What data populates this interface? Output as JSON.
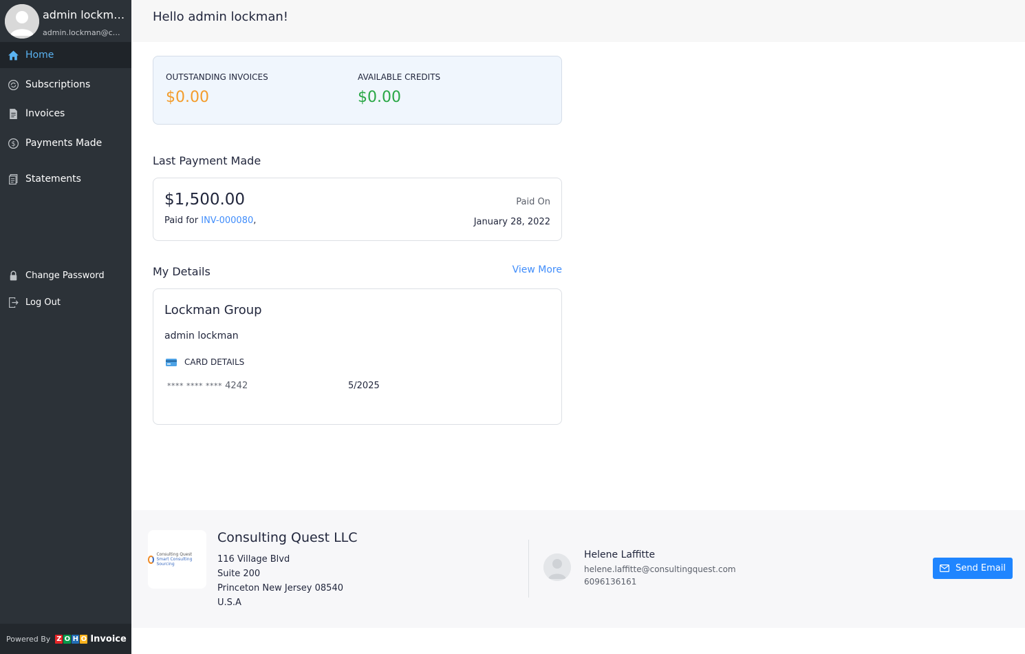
{
  "profile": {
    "name": "admin lockman",
    "email": "admin.lockman@consultingquest.com"
  },
  "nav": {
    "home": "Home",
    "subscriptions": "Subscriptions",
    "invoices": "Invoices",
    "payments_made": "Payments Made",
    "statements": "Statements",
    "change_password": "Change Password",
    "log_out": "Log Out"
  },
  "powered_by": {
    "label": "Powered By",
    "brand_letters": [
      "Z",
      "O",
      "H",
      "O"
    ],
    "product": "Invoice"
  },
  "header": {
    "greeting": "Hello admin lockman!"
  },
  "summary": {
    "outstanding_label": "OUTSTANDING INVOICES",
    "outstanding_value": "$0.00",
    "credits_label": "AVAILABLE CREDITS",
    "credits_value": "$0.00"
  },
  "last_payment": {
    "title": "Last Payment Made",
    "amount": "$1,500.00",
    "paid_for_label": "Paid for",
    "invoice_number": "INV-000080",
    "invoice_suffix": ",",
    "paid_on_label": "Paid On",
    "paid_on_date": "January 28, 2022"
  },
  "my_details": {
    "title": "My Details",
    "view_more": "View More",
    "company": "Lockman Group",
    "contact": "admin lockman",
    "card_details_label": "CARD DETAILS",
    "card_mask": "**** **** ****",
    "card_last4": "4242",
    "card_expiry": "5/2025"
  },
  "footer": {
    "org_name": "Consulting Quest LLC",
    "logo_text_1": "Consulting Quest",
    "logo_text_2": "Smart Consulting Sourcing",
    "address_lines": [
      "116 Village Blvd",
      "Suite 200",
      "Princeton New Jersey 08540",
      "U.S.A"
    ],
    "rep_name": "Helene Laffitte",
    "rep_email": "helene.laffitte@consultingquest.com",
    "rep_phone": "6096136161",
    "send_email": "Send Email"
  },
  "colors": {
    "sidebar_bg": "#2c3238",
    "active_link": "#5ab3f2",
    "accent_blue": "#408dfb",
    "outstanding_orange": "#f39c2b",
    "credits_green": "#29a745",
    "button_blue": "#1f85ff"
  },
  "icons": {
    "home": "home-icon",
    "subscriptions": "subscriptions-icon",
    "invoices": "invoice-icon",
    "payments_made": "dollar-circle-icon",
    "statements": "statement-icon",
    "change_password": "lock-icon",
    "log_out": "logout-icon",
    "card": "credit-card-icon",
    "send_email": "mail-icon"
  }
}
